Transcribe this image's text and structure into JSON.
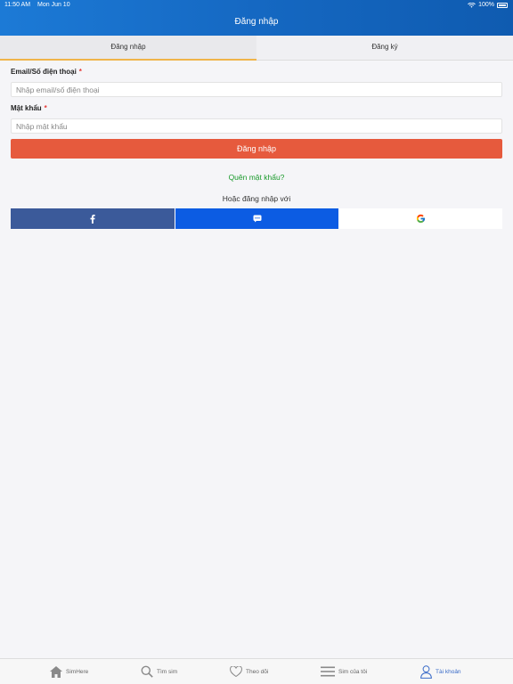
{
  "status_bar": {
    "time": "11:50 AM",
    "date": "Mon Jun 10",
    "battery": "100%"
  },
  "header": {
    "title": "Đăng nhập"
  },
  "tabs": [
    {
      "label": "Đăng nhập",
      "active": true
    },
    {
      "label": "Đăng ký",
      "active": false
    }
  ],
  "form": {
    "email_label": "Email/Số điện thoại",
    "email_placeholder": "Nhập email/số điện thoại",
    "password_label": "Mật khẩu",
    "password_placeholder": "Nhập mật khẩu",
    "required_mark": "*",
    "submit_label": "Đăng nhập",
    "forgot_label": "Quên mật khẩu?",
    "or_label": "Hoặc đăng nhập với"
  },
  "social": [
    {
      "icon": "facebook-icon",
      "color": "#3b5a9a"
    },
    {
      "icon": "zalo-icon",
      "color": "#0c5ce3"
    },
    {
      "icon": "google-icon",
      "color": "#ffffff"
    }
  ],
  "tabbar": [
    {
      "label": "SimHere",
      "icon": "home-icon",
      "active": false
    },
    {
      "label": "Tìm sim",
      "icon": "search-icon",
      "active": false
    },
    {
      "label": "Theo dõi",
      "icon": "heart-icon",
      "active": false
    },
    {
      "label": "Sim của tôi",
      "icon": "list-icon",
      "active": false
    },
    {
      "label": "Tài khoản",
      "icon": "user-icon",
      "active": true
    }
  ],
  "colors": {
    "header": "#1568c2",
    "accent": "#e65a3d",
    "link": "#1a9a2b",
    "active_tab": "#3b6cc8"
  }
}
